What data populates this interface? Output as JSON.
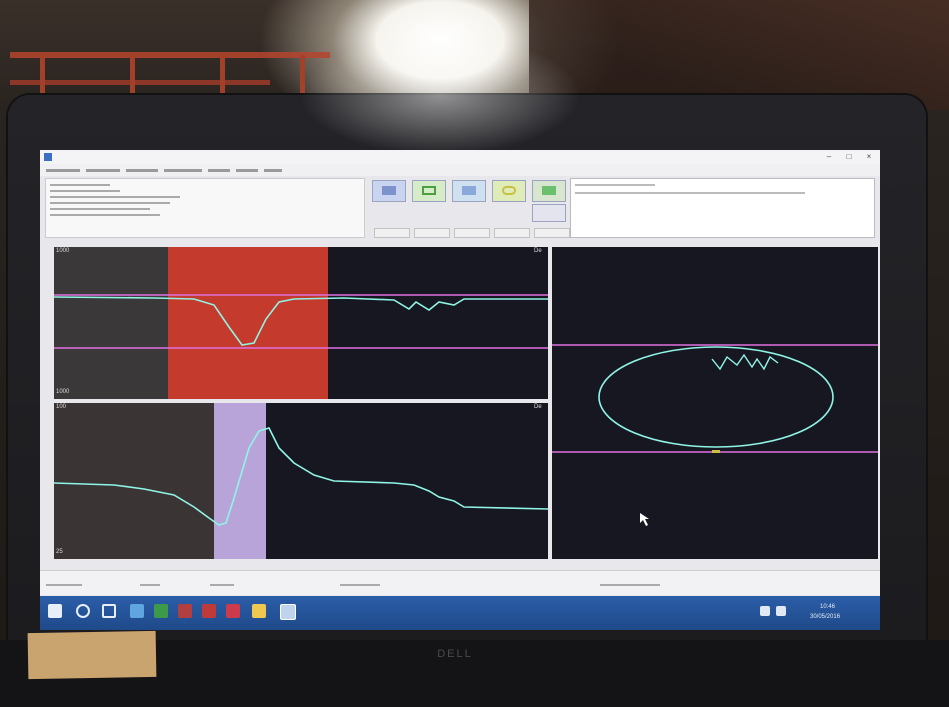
{
  "brand": "DELL",
  "screen": {
    "panels": {
      "top_left_label_top": "1000",
      "top_left_label_bottom": "1000",
      "bottom_left_label_top": "100",
      "bottom_left_label_bottom": "25",
      "panel_corner_a": "De",
      "panel_corner_b": "De"
    },
    "taskbar": {
      "clock_time": "10:46",
      "clock_date": "30/05/2016"
    }
  },
  "colors": {
    "trace": "#8ff5e6",
    "gate_line": "#e070e0",
    "red_zone": "#c43a2c",
    "lilac_zone": "#b8a4d8",
    "panel_bg": "#171722",
    "taskbar": "#2453a0"
  },
  "icons": [
    "start-icon",
    "search-icon",
    "task-view-icon",
    "file-icon",
    "chrome-icon",
    "app-icon",
    "app-icon",
    "folder-icon",
    "app-icon",
    "network-icon",
    "volume-icon"
  ]
}
